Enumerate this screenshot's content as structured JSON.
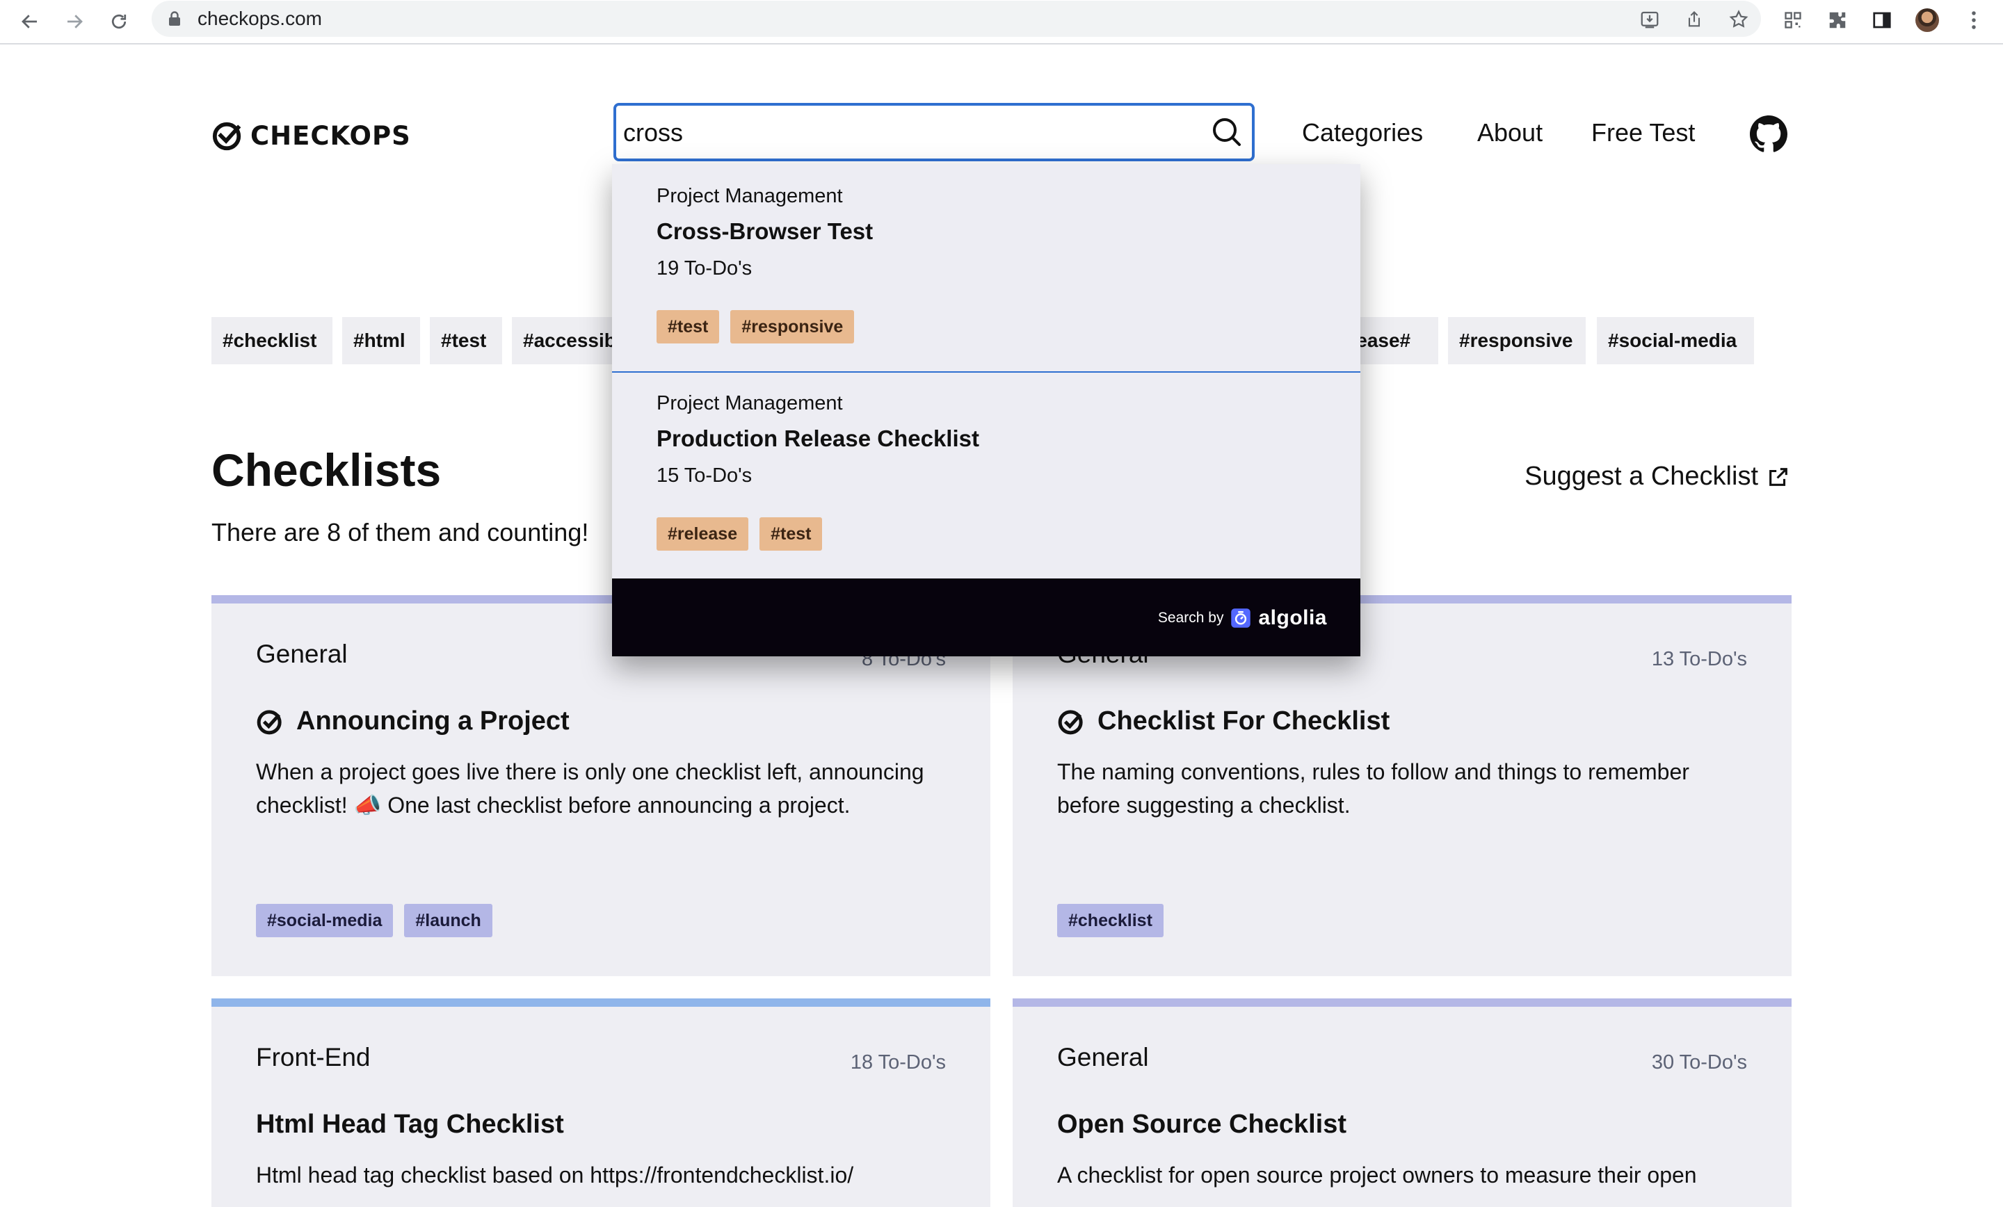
{
  "browser": {
    "url": "checkops.com"
  },
  "header": {
    "logo_text": "CHECKOPS",
    "search_value": "cross",
    "nav": [
      {
        "label": "Categories"
      },
      {
        "label": "About"
      },
      {
        "label": "Free Test"
      }
    ]
  },
  "tagbar": {
    "tags": [
      "#checklist",
      "#html",
      "#test",
      "#accessibility",
      "#release",
      "#responsive",
      "#social-media"
    ]
  },
  "section": {
    "title": "Checklists",
    "subtitle": "There are 8 of them and counting!",
    "suggest_label": "Suggest a Checklist"
  },
  "cards": [
    {
      "category": "General",
      "count": "8 To-Do's",
      "title": "Announcing a Project",
      "description": "When a project goes live there is only one checklist left, announcing checklist! 📣 One last checklist before announcing a project.",
      "tags": [
        "#social-media",
        "#launch"
      ]
    },
    {
      "category": "General",
      "count": "13 To-Do's",
      "title": "Checklist For Checklist",
      "description": "The naming conventions, rules to follow and things to remember before suggesting a checklist.",
      "tags": [
        "#checklist"
      ]
    },
    {
      "category": "Front-End",
      "count": "18 To-Do's",
      "title": "Html Head Tag Checklist",
      "description": "Html head tag checklist based on https://frontendchecklist.io/",
      "tags": []
    },
    {
      "category": "General",
      "count": "30 To-Do's",
      "title": "Open Source Checklist",
      "description": "A checklist for open source project owners to measure their open",
      "tags": []
    }
  ],
  "autocomplete": {
    "hits": [
      {
        "category": "Project Management",
        "title": "Cross-Browser Test",
        "count": "19 To-Do's",
        "tags": [
          "#test",
          "#responsive"
        ]
      },
      {
        "category": "Project Management",
        "title": "Production Release Checklist",
        "count": "15 To-Do's",
        "tags": [
          "#release",
          "#test"
        ]
      }
    ],
    "footer_by": "Search by",
    "footer_brand": "algolia"
  },
  "colors": {
    "accent_blue": "#2f6fd0",
    "card_bg": "#eeeef3",
    "tag_purple": "#b4b7e6",
    "tag_orange": "#e8b98f",
    "footer_black": "#07030d"
  }
}
